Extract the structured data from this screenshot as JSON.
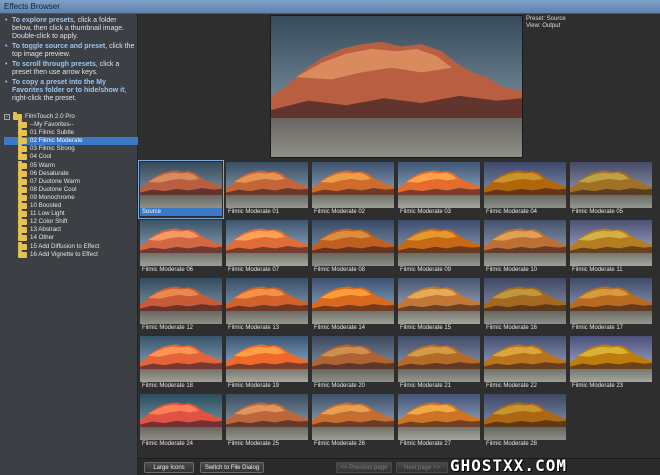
{
  "window": {
    "title": "Effects Browser"
  },
  "help": [
    {
      "keyword": "To explore presets",
      "text": ", click a folder below, then click a thumbnail image. Double-click to apply."
    },
    {
      "keyword": "To toggle source and preset",
      "text": ", click the top image preview."
    },
    {
      "keyword": "To scroll through presets",
      "text": ", click a preset then use arrow keys."
    },
    {
      "keyword": "To copy a preset into the My Favorites folder or to hide/show it",
      "text": ", right-click the preset."
    }
  ],
  "tree": {
    "root": "FilmTouch 2.0 Pro",
    "items": [
      "--My Favorites--",
      "01 Filmic Subtle",
      "02 Filmic Moderate",
      "03 Filmic Strong",
      "04 Cool",
      "05 Warm",
      "06 Desaturate",
      "07 Duotone Warm",
      "08 Duotone Cool",
      "09 Monochrome",
      "10 Boosted",
      "11 Low Light",
      "12 Color Shift",
      "13 Abstract",
      "14 Other",
      "15 Add Diffusion to Effect",
      "16 Add Vignette to Effect"
    ],
    "selected_index": 2
  },
  "preview": {
    "preset_line": "Preset: Source",
    "view_line": "View: Output"
  },
  "thumbnails": [
    "Source",
    "Filmic Moderate 01",
    "Filmic Moderate 02",
    "Filmic Moderate 03",
    "Filmic Moderate 04",
    "Filmic Moderate 05",
    "Filmic Moderate 06",
    "Filmic Moderate 07",
    "Filmic Moderate 08",
    "Filmic Moderate 09",
    "Filmic Moderate 10",
    "Filmic Moderate 11",
    "Filmic Moderate 12",
    "Filmic Moderate 13",
    "Filmic Moderate 14",
    "Filmic Moderate 15",
    "Filmic Moderate 16",
    "Filmic Moderate 17",
    "Filmic Moderate 18",
    "Filmic Moderate 19",
    "Filmic Moderate 20",
    "Filmic Moderate 21",
    "Filmic Moderate 22",
    "Filmic Moderate 23",
    "Filmic Moderate 24",
    "Filmic Moderate 25",
    "Filmic Moderate 26",
    "Filmic Moderate 27",
    "Filmic Moderate 28"
  ],
  "selected_thumbnail": 0,
  "buttons": {
    "large_icons": "Large Icons",
    "switch_dialog": "Switch to File Dialog",
    "prev_page": "<< Previous page",
    "next_page": "Next page >>"
  },
  "watermark": "GHOSTXX.COM",
  "colors": {
    "accent": "#3a78c8",
    "folder": "#e6c24e",
    "panel": "#3c3f44",
    "background": "#2e2e2e"
  }
}
